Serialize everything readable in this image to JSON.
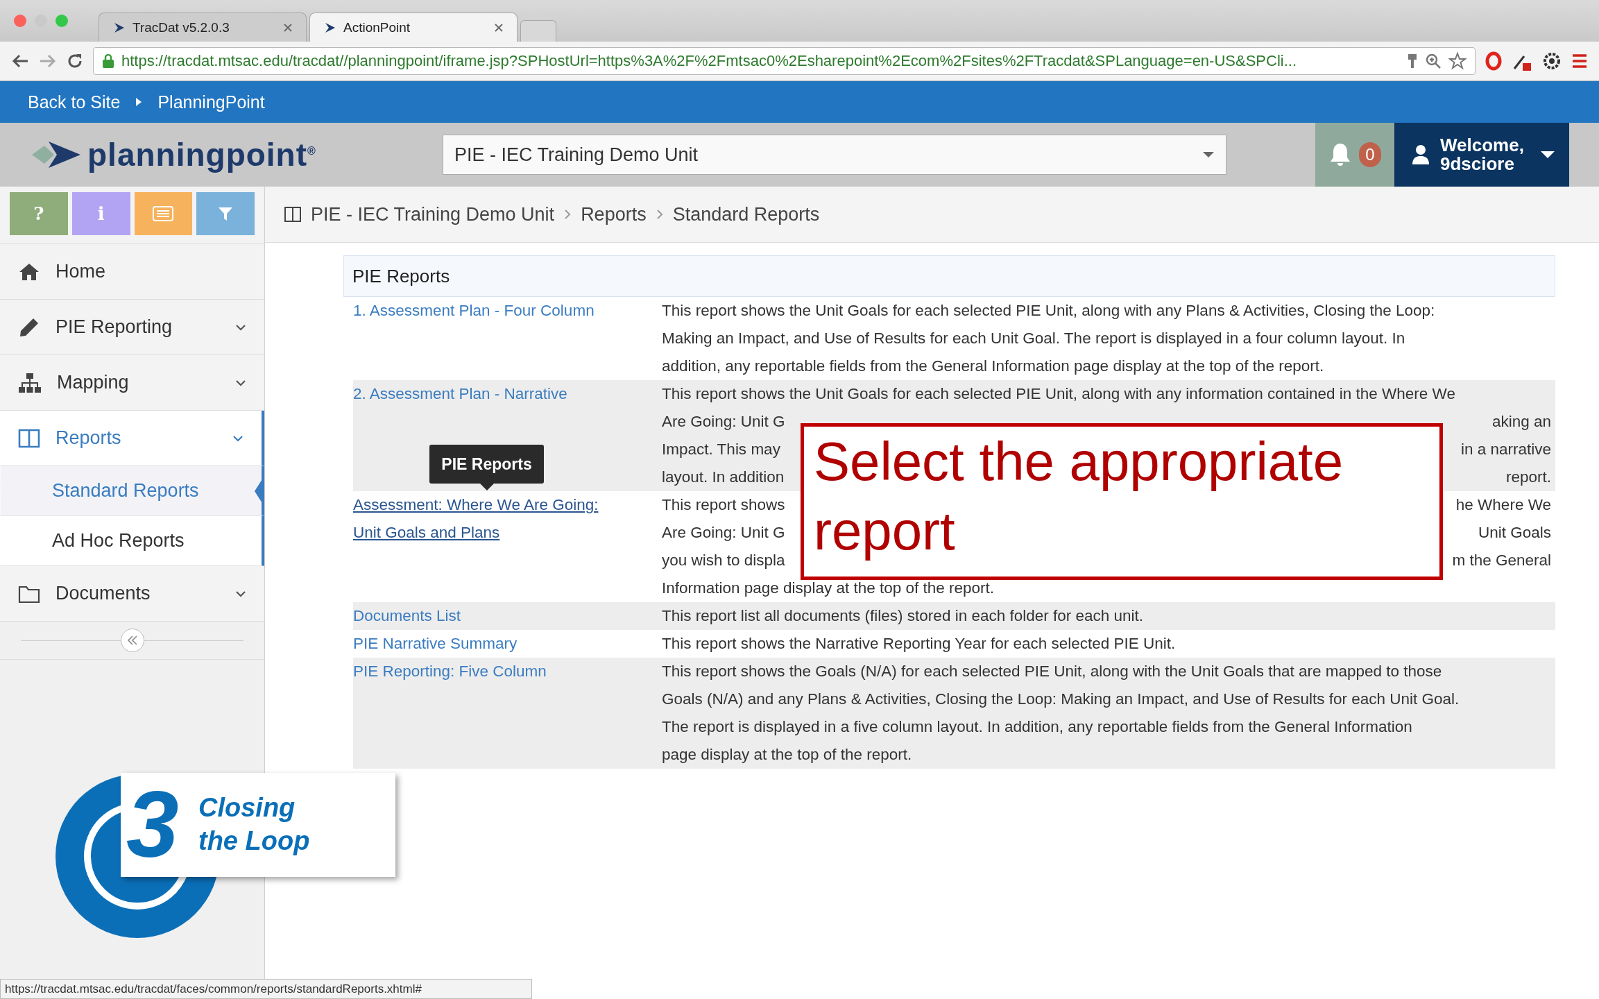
{
  "browser": {
    "tabs": [
      {
        "title": "TracDat v5.2.0.3",
        "selected": false
      },
      {
        "title": "ActionPoint",
        "selected": true
      }
    ],
    "address_bar": {
      "url": "https://tracdat.mtsac.edu/tracdat//planningpoint/iframe.jsp?SPHostUrl=https%3A%2F%2Fmtsac0%2Esharepoint%2Ecom%2Fsites%2FTracdat&SPLanguage=en-US&SPCli..."
    },
    "status_bar": "https://tracdat.mtsac.edu/tracdat/faces/common/reports/standardReports.xhtml#"
  },
  "site_nav": [
    "Back to Site",
    "PlanningPoint"
  ],
  "header": {
    "logo": "planningpoint$^{®}$",
    "unit_select": "PIE - IEC Training Demo Unit",
    "notification_count": "0",
    "greeting": "Welcome,",
    "username": "9dsciore"
  },
  "sidebar": {
    "tool_buttons": [
      {
        "kind": "text",
        "label": "?",
        "color": "#8fad7b"
      },
      {
        "kind": "text",
        "label": "i",
        "color": "#b3a4f3"
      },
      {
        "kind": "list",
        "color": "#f6b25d"
      },
      {
        "kind": "filter",
        "color": "#7ab2dc"
      }
    ],
    "items": [
      {
        "label": "Home",
        "selected": false
      },
      {
        "label": "PIE Reporting",
        "selected": false
      },
      {
        "label": "Mapping",
        "selected": false
      },
      {
        "label": "Reports",
        "selected": true,
        "children": [
          {
            "label": "Standard Reports",
            "selected": true
          },
          {
            "label": "Ad Hoc Reports",
            "selected": false
          }
        ]
      },
      {
        "label": "Documents",
        "selected": false
      }
    ]
  },
  "breadcrumb": [
    "PIE - IEC Training Demo Unit",
    "Reports",
    "Standard Reports"
  ],
  "reports": {
    "title": "PIE Reports",
    "rows": [
      {
        "name": [
          "1. Assessment Plan - Four Column"
        ],
        "hovered": false,
        "lines": [
          [
            "This report shows the Unit Goals for each selected PIE Unit, along with any Plans & Activities, Closing the Loop:"
          ],
          [
            "Making an Impact, and Use of Results for each Unit Goal. The report is displayed in a four column layout. In"
          ],
          [
            "addition, any reportable fields from the General Information page display at the top of the report."
          ]
        ]
      },
      {
        "name": [
          "2. Assessment Plan - Narrative"
        ],
        "hovered": false,
        "lines": [
          [
            "This report shows the Unit Goals for each selected PIE Unit, along with any information contained in the Where We"
          ],
          [
            "Are Going: Unit G",
            "aking an"
          ],
          [
            "Impact. This may",
            "in a narrative"
          ],
          [
            "layout. In addition",
            "report."
          ]
        ]
      },
      {
        "name": [
          "Assessment: Where We Are Going:",
          "Unit Goals and Plans"
        ],
        "hovered": true,
        "lines": [
          [
            "This report shows",
            "he Where We"
          ],
          [
            "Are Going: Unit G",
            "Unit Goals"
          ],
          [
            "you wish to displa",
            "m the General"
          ],
          [
            "Information page display at the top of the report."
          ]
        ]
      },
      {
        "name": [
          "Documents List"
        ],
        "hovered": false,
        "lines": [
          [
            "This report list all documents (files) stored in each folder for each unit."
          ]
        ]
      },
      {
        "name": [
          "PIE Narrative Summary"
        ],
        "hovered": false,
        "lines": [
          [
            "This report shows the Narrative Reporting Year for each selected PIE Unit."
          ]
        ]
      },
      {
        "name": [
          "PIE Reporting: Five Column"
        ],
        "hovered": false,
        "lines": [
          [
            "This report shows the Goals (N/A) for each selected PIE Unit, along with the Unit Goals that are mapped to those"
          ],
          [
            "Goals (N/A) and any Plans & Activities, Closing the Loop: Making an Impact, and Use of Results for each Unit Goal."
          ],
          [
            "The report is displayed in a five column layout. In addition, any reportable fields from the General Information"
          ],
          [
            "page display at the top of the report."
          ]
        ]
      }
    ]
  },
  "tooltip": "PIE Reports",
  "callout": "Select the appropriate report",
  "step_badge": {
    "number": "3",
    "title": [
      "Closing",
      "the Loop"
    ]
  }
}
